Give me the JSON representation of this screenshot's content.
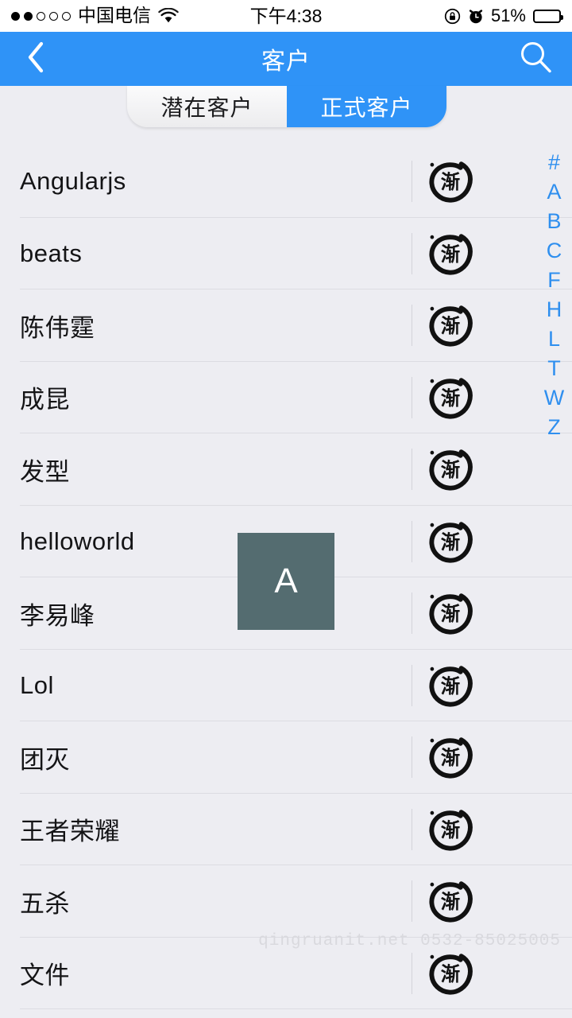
{
  "status_bar": {
    "signal_dots_total": 5,
    "signal_dots_filled": 2,
    "carrier": "中国电信",
    "wifi_icon": "wifi-icon",
    "time": "下午4:38",
    "rotation_lock_icon": "rotation-lock-icon",
    "alarm_icon": "alarm-clock-icon",
    "battery_percent": "51%",
    "battery_level": 51
  },
  "nav_bar": {
    "back_icon": "chevron-left-icon",
    "title": "客户",
    "search_icon": "search-icon",
    "background_color": "#2f93f7"
  },
  "segment_control": {
    "tabs": [
      {
        "label": "潜在客户",
        "active": false
      },
      {
        "label": "正式客户",
        "active": true
      }
    ],
    "active_color": "#2f93f7"
  },
  "list": {
    "row_icon": "brand-stamp-icon",
    "row_icon_character": "渐",
    "items": [
      {
        "name": "Angularjs"
      },
      {
        "name": "beats"
      },
      {
        "name": "陈伟霆"
      },
      {
        "name": "成昆"
      },
      {
        "name": "发型"
      },
      {
        "name": "helloworld"
      },
      {
        "name": "李易峰"
      },
      {
        "name": "Lol"
      },
      {
        "name": "团灭"
      },
      {
        "name": "王者荣耀"
      },
      {
        "name": "五杀"
      },
      {
        "name": "文件"
      }
    ]
  },
  "index_bar": {
    "letters": [
      "#",
      "A",
      "B",
      "C",
      "F",
      "H",
      "L",
      "T",
      "W",
      "Z"
    ],
    "color": "#2f8fef"
  },
  "index_overlay": {
    "letter": "A",
    "background_color": "#546c70",
    "text_color": "#ffffff"
  },
  "watermark": {
    "text": "qingruanit.net  0532-85025005"
  }
}
